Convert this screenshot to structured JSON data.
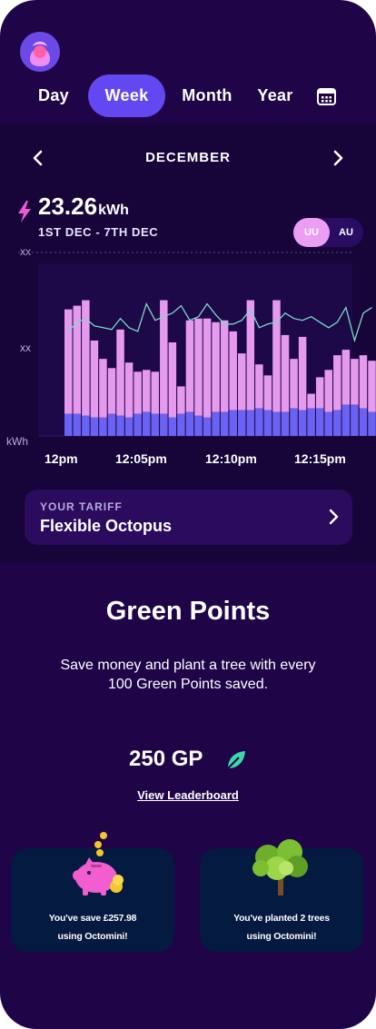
{
  "tabs": [
    {
      "label": "Day",
      "active": false
    },
    {
      "label": "Week",
      "active": true
    },
    {
      "label": "Month",
      "active": false
    },
    {
      "label": "Year",
      "active": false
    }
  ],
  "icons": {
    "calendar": "calendar-icon",
    "avatar": "avatar-icon",
    "bolt": "lightning-bolt-icon",
    "prev": "chevron-left-icon",
    "next": "chevron-right-icon",
    "leaf": "leaf-icon"
  },
  "usage": {
    "month": "DECEMBER",
    "total": "23.26",
    "unit": "kWh",
    "range": "1ST DEC - 7TH DEC",
    "toggle": {
      "selected": "UU",
      "other": "AU"
    }
  },
  "chart_data": {
    "type": "bar",
    "stacked": true,
    "y_tick_labels": [
      "xx",
      "xx",
      "kWh"
    ],
    "x_tick_labels": [
      "12pm",
      "12:05pm",
      "12:10pm",
      "12:15pm"
    ],
    "series": [
      {
        "values": [
          2.4,
          2.4,
          2.2,
          2.0,
          2.0,
          2.4,
          2.2,
          2.0,
          2.4,
          2.6,
          2.4,
          2.4,
          2.0,
          2.4,
          2.6,
          2.2,
          2.0,
          2.6,
          2.6,
          2.8,
          2.8,
          2.8,
          3.0,
          2.8,
          2.6,
          2.6,
          3.0,
          2.8,
          3.0,
          3.0,
          2.6,
          2.8,
          3.4,
          3.4,
          3.0,
          2.6
        ]
      },
      {
        "values": [
          11.4,
          11.8,
          12.6,
          8.4,
          6.4,
          5.0,
          9.4,
          6.0,
          4.6,
          4.6,
          4.6,
          12.4,
          8.2,
          3.0,
          10.0,
          10.6,
          10.8,
          9.8,
          10.0,
          8.6,
          6.2,
          12.0,
          4.8,
          3.8,
          12.2,
          8.4,
          5.4,
          8.0,
          1.6,
          3.4,
          4.6,
          6.0,
          6.0,
          5.0,
          5.8,
          5.6
        ]
      },
      {
        "values": [
          11.4,
          12.4,
          12.8,
          12.0,
          11.8,
          11.6,
          12.8,
          11.8,
          11.4,
          14.4,
          12.6,
          13.0,
          13.4,
          14.2,
          12.6,
          13.0,
          14.4,
          13.2,
          12.2,
          12.2,
          12.6,
          13.8,
          11.8,
          12.2,
          12.4,
          13.4,
          12.8,
          12.6,
          13.0,
          12.4,
          11.8,
          12.4,
          14.0,
          10.4,
          13.4,
          14.0
        ]
      }
    ],
    "colors": {
      "base": "#6a62f2",
      "top": "#e59aee",
      "line": "#7bd9c9",
      "plot_bg": "#1d0848"
    },
    "ylim": [
      0,
      20
    ]
  },
  "tariff": {
    "caption": "YOUR TARIFF",
    "name": "Flexible Octopus"
  },
  "green_points": {
    "title": "Green Points",
    "description": "Save money and plant a tree with every 100 Green Points saved.",
    "value": "250 GP",
    "leaderboard": "View Leaderboard"
  },
  "cards": [
    {
      "line1": "You've save £257.98",
      "line2": "using Octomini!",
      "icon": "piggy-bank-icon"
    },
    {
      "line1": "You've planted 2 trees",
      "line2": "using Octomini!",
      "icon": "tree-icon"
    }
  ]
}
